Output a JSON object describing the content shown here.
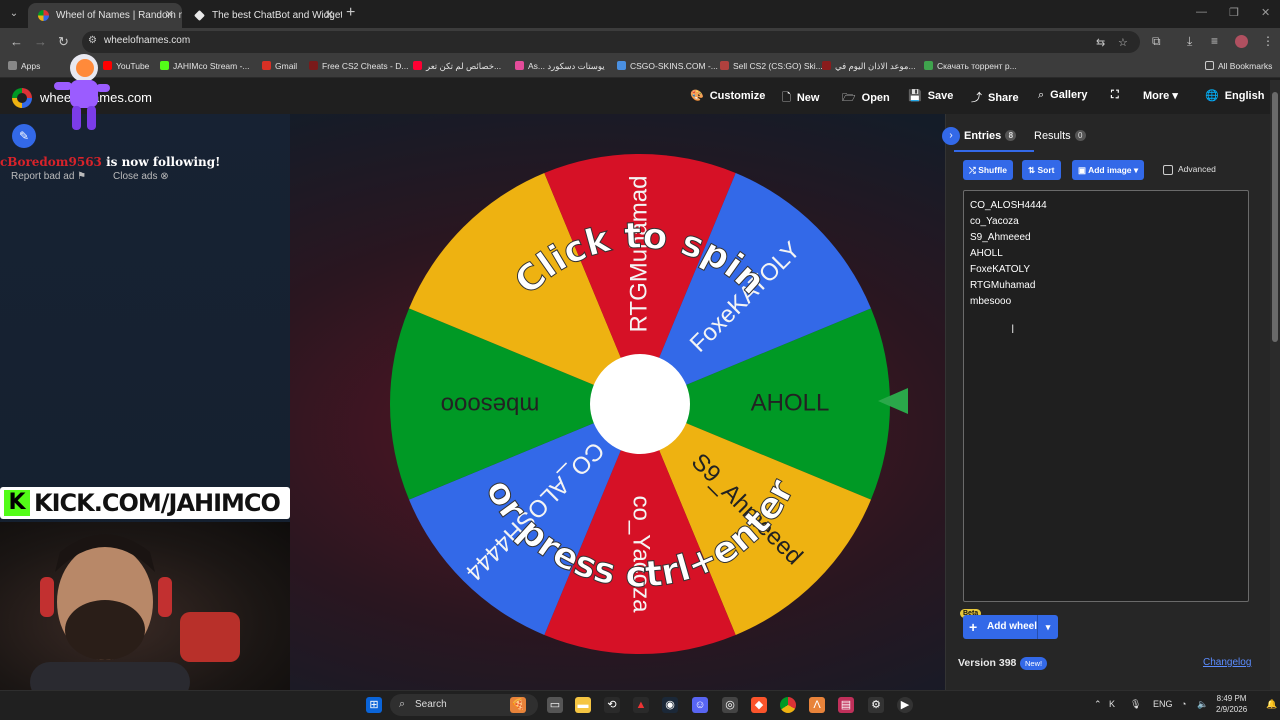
{
  "browser": {
    "tabs": [
      {
        "title": "Wheel of Names | Random nam",
        "active": true
      },
      {
        "title": "The best ChatBot and Widgets",
        "active": false
      }
    ],
    "url": "wheelofnames.com",
    "bookmarks": [
      "Apps",
      "YouTube",
      "JAHIMco Stream -...",
      "Gmail",
      "Free CS2 Cheats - D...",
      "خصائص لم تكن تعر...",
      "As... يوستات دسكورد",
      "CSGO-SKINS.COM -...",
      "Sell CS2 (CS:GO) Ski...",
      "موعد الاذان اليوم في...",
      "Скачать торрент р..."
    ],
    "all_bookmarks": "All Bookmarks"
  },
  "site": {
    "logo": "wheelofnames.com",
    "menu": {
      "customize": "Customize",
      "new": "New",
      "open": "Open",
      "save": "Save",
      "share": "Share",
      "gallery": "Gallery",
      "more": "More",
      "language": "English"
    }
  },
  "overlay": {
    "follower_user": "cBoredom9563",
    "follower_text": "is now following!",
    "report_ad": "Report bad ad",
    "close_ads": "Close ads",
    "kick_text": "KICK.COM/JAHIMCO"
  },
  "wheel": {
    "top_text": "Click to spin",
    "bottom_text": "or press ctrl+enter",
    "segments": [
      {
        "label": "AHOLL",
        "color": "#009925"
      },
      {
        "label": "S9_Ahmeeed",
        "color": "#eeb211"
      },
      {
        "label": "co_Yacoza",
        "color": "#d61126"
      },
      {
        "label": "CO_ALOSH4444",
        "color": "#3369e8"
      },
      {
        "label": "mbesooo",
        "color": "#009925"
      },
      {
        "label": "",
        "color": "#eeb211"
      },
      {
        "label": "RTGMuhamad",
        "color": "#d61126"
      },
      {
        "label": "FoxeKATOLY",
        "color": "#3369e8"
      }
    ]
  },
  "sidebar": {
    "entries_tab": "Entries",
    "entries_count": "8",
    "results_tab": "Results",
    "results_count": "0",
    "shuffle": "Shuffle",
    "sort": "Sort",
    "add_image": "Add image",
    "advanced": "Advanced",
    "entries": [
      "CO_ALOSH4444",
      "co_Yacoza",
      "S9_Ahmeeed",
      "AHOLL",
      "FoxeKATOLY",
      "RTGMuhamad",
      "mbesooo"
    ],
    "beta": "Beta",
    "add_wheel": "Add wheel",
    "version": "Version 398",
    "new_badge": "New!",
    "changelog": "Changelog"
  },
  "taskbar": {
    "search_placeholder": "Search",
    "lang": "ENG",
    "time": "8:49 PM",
    "date": "2/9/2026"
  }
}
